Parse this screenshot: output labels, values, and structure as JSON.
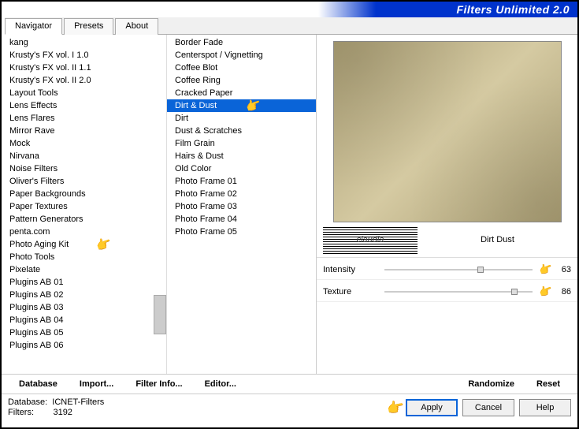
{
  "header": {
    "title": "Filters Unlimited 2.0"
  },
  "tabs": [
    {
      "label": "Navigator",
      "active": true
    },
    {
      "label": "Presets",
      "active": false
    },
    {
      "label": "About",
      "active": false
    }
  ],
  "categories": [
    "kang",
    "Krusty's FX vol. I 1.0",
    "Krusty's FX vol. II 1.1",
    "Krusty's FX vol. II 2.0",
    "Layout Tools",
    "Lens Effects",
    "Lens Flares",
    "Mirror Rave",
    "Mock",
    "Nirvana",
    "Noise Filters",
    "Oliver's Filters",
    "Paper Backgrounds",
    "Paper Textures",
    "Pattern Generators",
    "penta.com",
    "Photo Aging Kit",
    "Photo Tools",
    "Pixelate",
    "Plugins AB 01",
    "Plugins AB 02",
    "Plugins AB 03",
    "Plugins AB 04",
    "Plugins AB 05",
    "Plugins AB 06"
  ],
  "category_pointer_index": 16,
  "filters": [
    "Border Fade",
    "Centerspot / Vignetting",
    "Coffee Blot",
    "Coffee Ring",
    "Cracked Paper",
    "Dirt & Dust",
    "Dirt",
    "Dust & Scratches",
    "Film Grain",
    "Hairs & Dust",
    "Old Color",
    "Photo Frame 01",
    "Photo Frame 02",
    "Photo Frame 03",
    "Photo Frame 04",
    "Photo Frame 05"
  ],
  "filter_selected_index": 5,
  "watermark_text": "claudia",
  "filter_info": {
    "name": "Dirt  Dust"
  },
  "sliders": [
    {
      "label": "Intensity",
      "value": 63
    },
    {
      "label": "Texture",
      "value": 86
    }
  ],
  "toolbar": {
    "database": "Database",
    "import": "Import...",
    "filter_info": "Filter Info...",
    "editor": "Editor...",
    "randomize": "Randomize",
    "reset": "Reset"
  },
  "footer": {
    "db_label": "Database:",
    "db_value": "ICNET-Filters",
    "filters_label": "Filters:",
    "filters_value": "3192",
    "apply": "Apply",
    "cancel": "Cancel",
    "help": "Help"
  }
}
